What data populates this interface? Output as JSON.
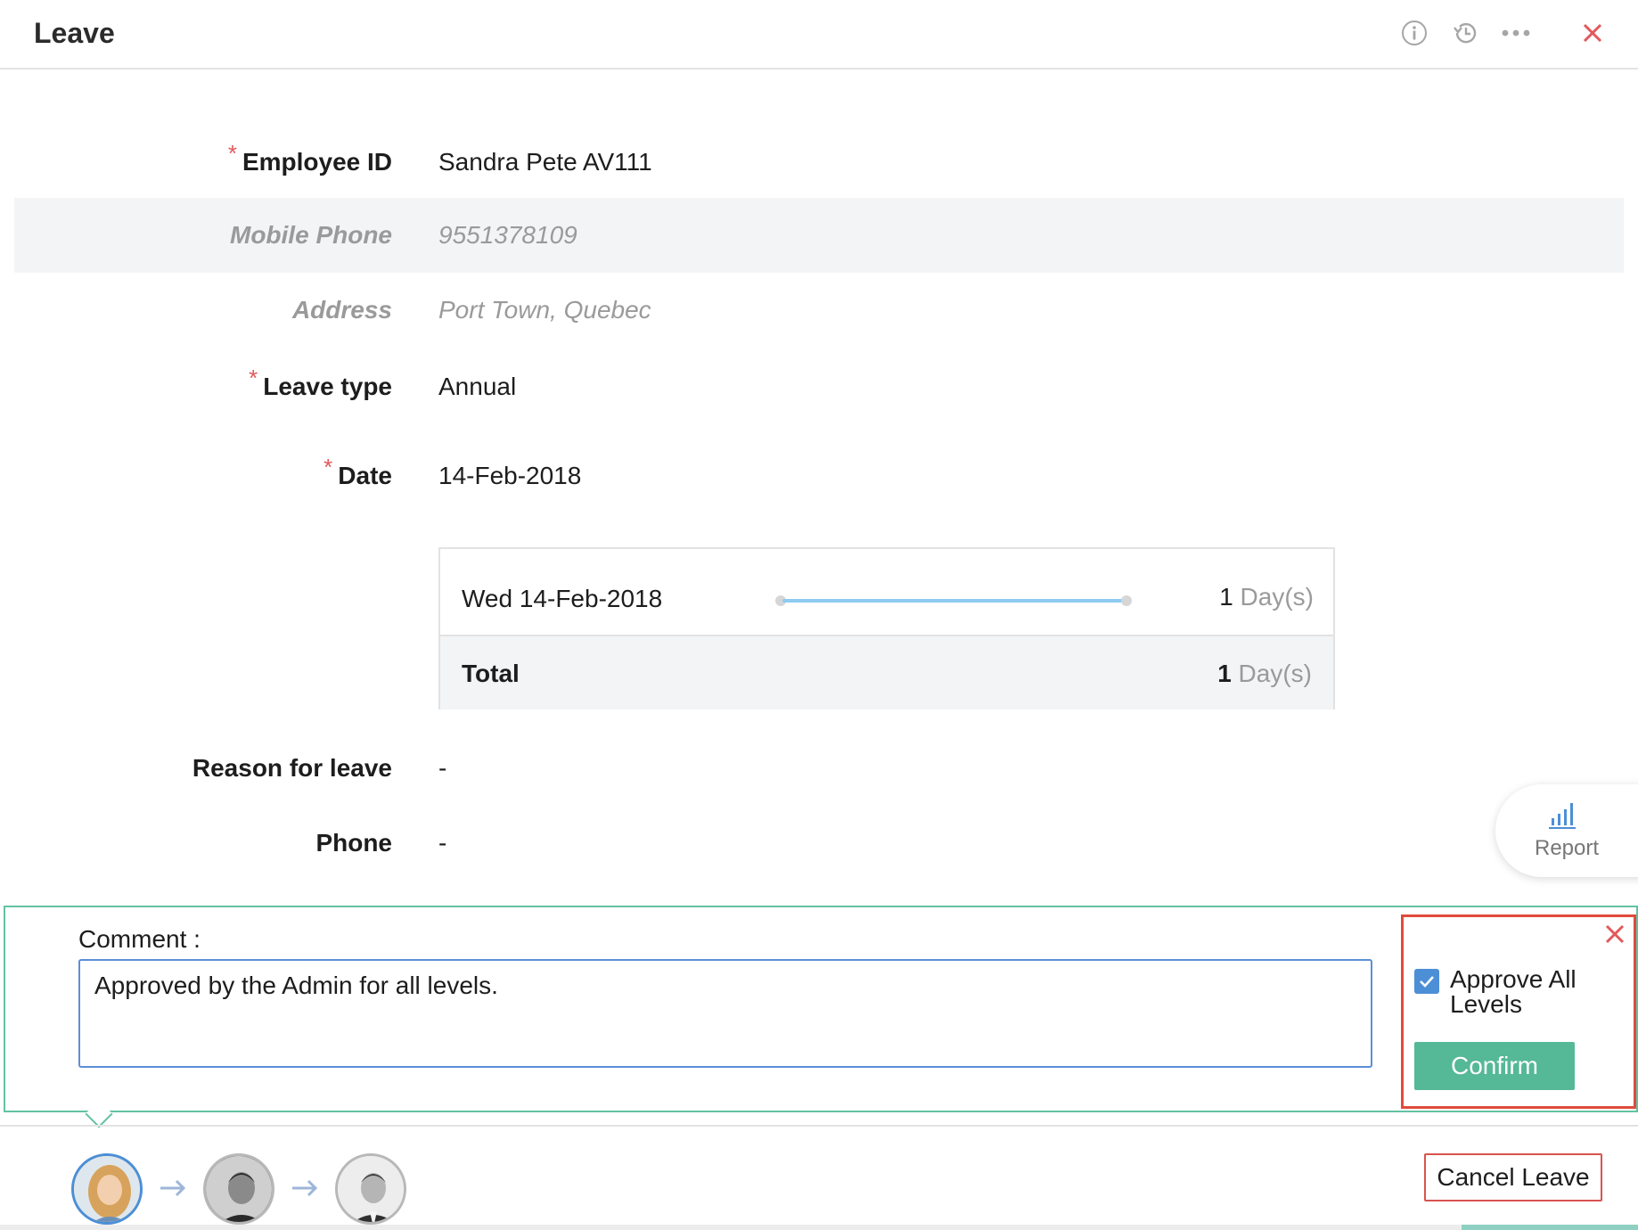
{
  "header": {
    "title": "Leave",
    "icons": [
      "info-icon",
      "history-icon",
      "more-icon",
      "close-icon"
    ],
    "close_color": "#e2595b"
  },
  "form": {
    "employee_id": {
      "label": "Employee ID",
      "value": "Sandra Pete AV111",
      "required": true
    },
    "mobile_phone": {
      "label": "Mobile Phone",
      "value": "9551378109"
    },
    "address": {
      "label": "Address",
      "value": "Port Town, Quebec"
    },
    "leave_type": {
      "label": "Leave type",
      "value": "Annual",
      "required": true
    },
    "date": {
      "label": "Date",
      "value": "14-Feb-2018",
      "required": true
    },
    "reason": {
      "label": "Reason for leave",
      "value": "-"
    },
    "phone": {
      "label": "Phone",
      "value": "-"
    },
    "required_marker": "*"
  },
  "day_table": {
    "rows": [
      {
        "date": "Wed 14-Feb-2018",
        "count": "1",
        "unit": "Day(s)",
        "fraction": 1.0
      }
    ],
    "total": {
      "label": "Total",
      "count": "1",
      "unit": "Day(s)"
    }
  },
  "report": {
    "label": "Report"
  },
  "approval": {
    "comment_label": "Comment :",
    "comment_value": "Approved by the Admin for all levels.",
    "approve_all_label": "Approve All Levels",
    "approve_all_checked": true,
    "confirm_label": "Confirm",
    "highlight_color": "#e04a3c",
    "accent_color": "#55b896"
  },
  "footer": {
    "approvers": [
      "avatar-approver-1",
      "avatar-approver-2",
      "avatar-approver-3"
    ],
    "cancel_label": "Cancel Leave"
  }
}
